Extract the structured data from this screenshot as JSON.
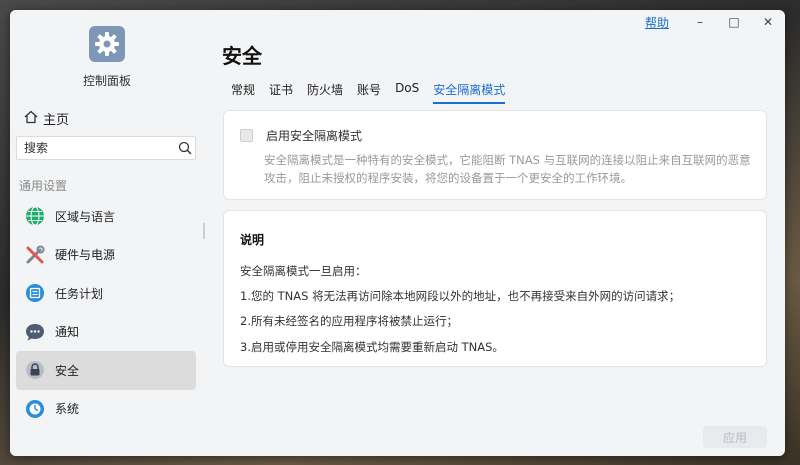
{
  "app": {
    "title": "控制面板"
  },
  "titlebar": {
    "help": "帮助",
    "minimize": "–",
    "maximize": "□",
    "close": "✕"
  },
  "sidebar": {
    "home": "主页",
    "search": {
      "value": "",
      "placeholder": "搜索"
    },
    "section": "通用设置",
    "items": [
      {
        "label": "区域与语言",
        "icon": "globe-icon"
      },
      {
        "label": "硬件与电源",
        "icon": "tools-icon"
      },
      {
        "label": "任务计划",
        "icon": "calendar-icon"
      },
      {
        "label": "通知",
        "icon": "chat-icon"
      },
      {
        "label": "安全",
        "icon": "lock-icon",
        "active": true
      },
      {
        "label": "系统",
        "icon": "clock-icon"
      }
    ]
  },
  "main": {
    "title": "安全",
    "tabs": [
      {
        "label": "常规"
      },
      {
        "label": "证书"
      },
      {
        "label": "防火墙"
      },
      {
        "label": "账号"
      },
      {
        "label": "DoS"
      },
      {
        "label": "安全隔离模式",
        "active": true
      }
    ],
    "isolation": {
      "checkbox_label": "启用安全隔离模式",
      "checked": false,
      "description": "安全隔离模式是一种特有的安全模式，它能阻断 TNAS 与互联网的连接以阻止来自互联网的恶意攻击，阻止未授权的程序安装，将您的设备置于一个更安全的工作环境。"
    },
    "notes": {
      "heading": "说明",
      "intro": "安全隔离模式一旦启用：",
      "lines": [
        "1.您的 TNAS 将无法再访问除本地网段以外的地址，也不再接受来自外网的访问请求；",
        "2.所有未经签名的应用程序将被禁止运行；",
        "3.启用或停用安全隔离模式均需要重新启动 TNAS。"
      ]
    },
    "apply": "应用"
  },
  "colors": {
    "accent": "#1a6fd0",
    "active_nav": "#dcdcdc",
    "app_icon": "#7f97b6"
  }
}
